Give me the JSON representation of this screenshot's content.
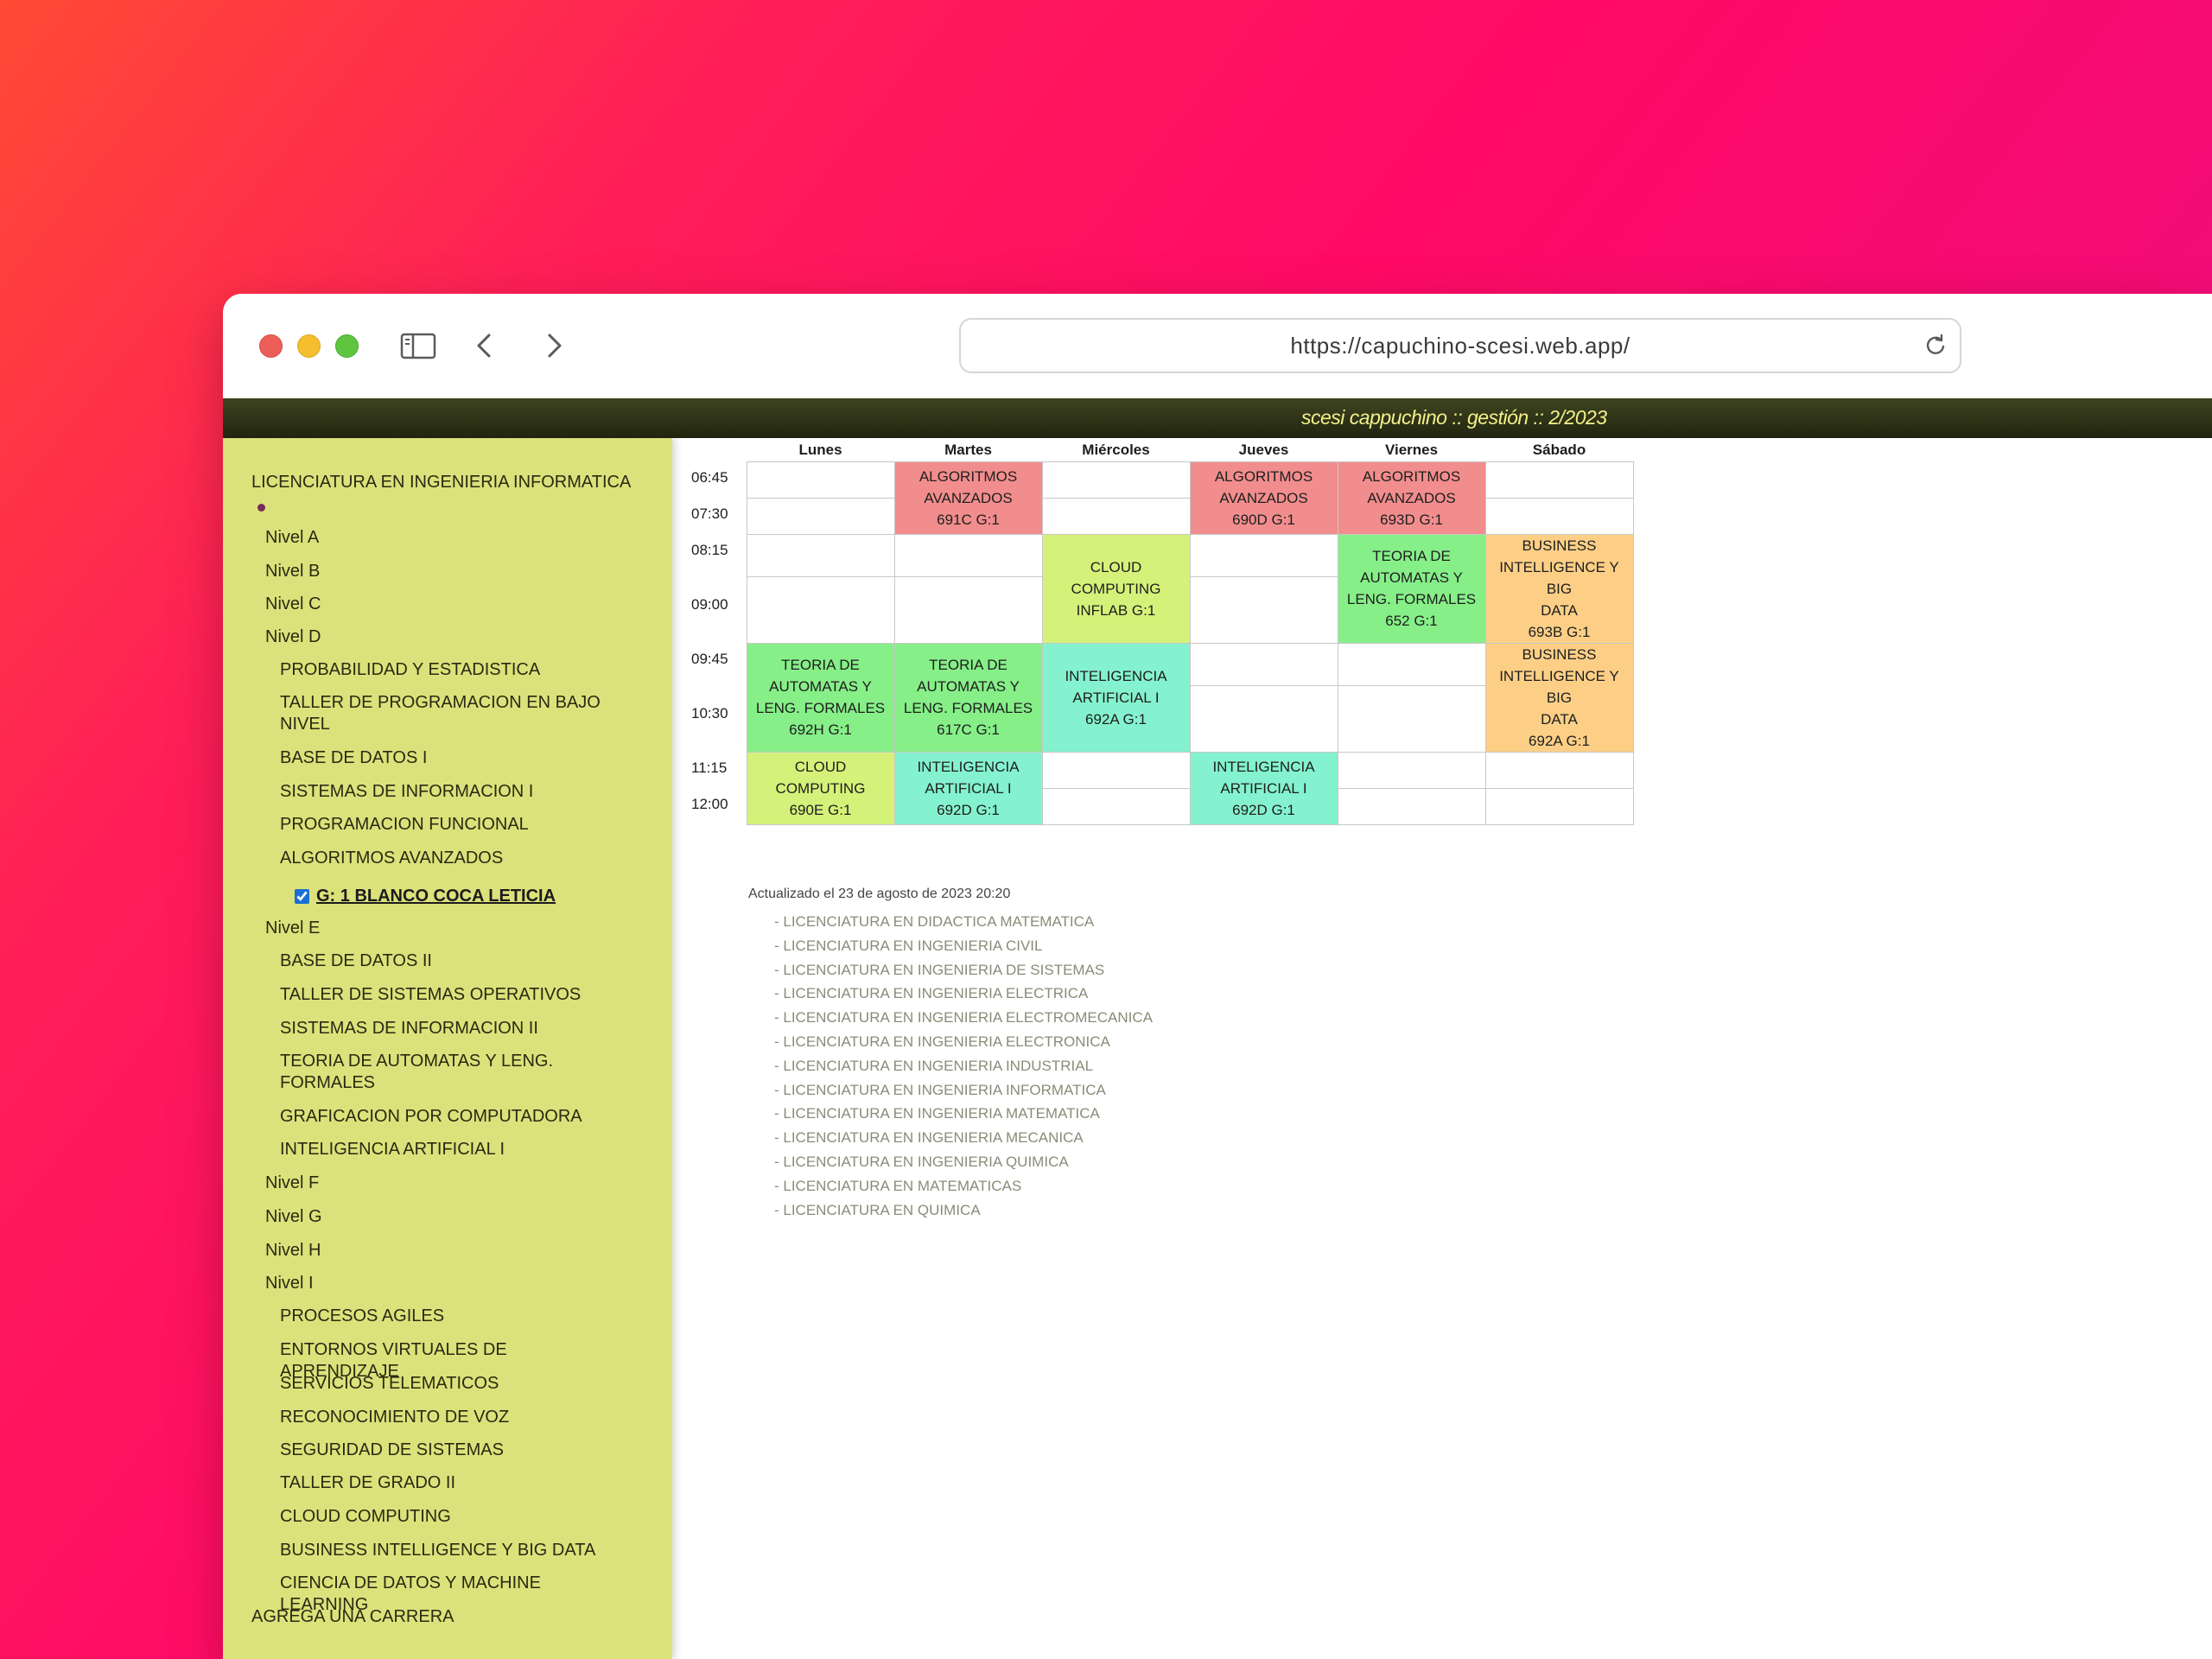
{
  "browser": {
    "url": "https://capuchino-scesi.web.app/",
    "icons": [
      "sidebar-toggle-icon",
      "back-arrow-icon",
      "forward-arrow-icon",
      "reload-icon"
    ]
  },
  "header": {
    "title": "scesi cappuchino :: gestión :: 2/2023"
  },
  "sidebar": {
    "career": "LICENCIATURA EN INGENIERIA INFORMATICA",
    "levels": {
      "a": "Nivel A",
      "b": "Nivel B",
      "c": "Nivel C",
      "d": "Nivel D",
      "e": "Nivel E",
      "f": "Nivel F",
      "g": "Nivel G",
      "h": "Nivel H",
      "i": "Nivel I"
    },
    "nivel_d_subjects": [
      "PROBABILIDAD Y ESTADISTICA",
      "TALLER DE PROGRAMACION EN BAJO NIVEL",
      "BASE DE DATOS I",
      "SISTEMAS DE INFORMACION I",
      "PROGRAMACION FUNCIONAL",
      "ALGORITMOS AVANZADOS"
    ],
    "selected_group": {
      "label": "G: 1 BLANCO COCA LETICIA",
      "checked": true
    },
    "nivel_e_subjects": [
      "BASE DE DATOS II",
      "TALLER DE SISTEMAS OPERATIVOS",
      "SISTEMAS DE INFORMACION II",
      "TEORIA DE AUTOMATAS Y LENG. FORMALES",
      "GRAFICACION POR COMPUTADORA",
      "INTELIGENCIA ARTIFICIAL I"
    ],
    "nivel_i_subjects": [
      "PROCESOS AGILES",
      "ENTORNOS VIRTUALES DE APRENDIZAJE",
      "SERVICIOS TELEMATICOS",
      "RECONOCIMIENTO DE VOZ",
      "SEGURIDAD DE SISTEMAS",
      "TALLER DE GRADO II",
      "CLOUD COMPUTING",
      "BUSINESS INTELLIGENCE Y BIG DATA",
      "CIENCIA DE DATOS Y MACHINE LEARNING"
    ],
    "add_career": "AGREGA UNA CARRERA"
  },
  "schedule": {
    "days": [
      "Lunes",
      "Martes",
      "Miércoles",
      "Jueves",
      "Viernes",
      "Sábado"
    ],
    "times": [
      "06:45",
      "07:30",
      "08:15",
      "09:00",
      "09:45",
      "10:30",
      "11:15",
      "12:00"
    ],
    "colors": {
      "red": "#f28d8d",
      "lime": "#d4f279",
      "green": "#86ef88",
      "orange": "#fdcf86",
      "teal": "#84f2cf"
    },
    "cells": {
      "mar_0645": [
        "ALGORITMOS",
        "AVANZADOS",
        "691C G:1"
      ],
      "jue_0645": [
        "ALGORITMOS",
        "AVANZADOS",
        "690D G:1"
      ],
      "vie_0645": [
        "ALGORITMOS",
        "AVANZADOS",
        "693D G:1"
      ],
      "mie_0815": [
        "CLOUD",
        "COMPUTING",
        "INFLAB G:1"
      ],
      "vie_0815": [
        "TEORIA DE",
        "AUTOMATAS Y",
        "LENG. FORMALES",
        "652 G:1"
      ],
      "sab_0815": [
        "BUSINESS",
        "INTELLIGENCE Y BIG",
        "DATA",
        "693B G:1"
      ],
      "lun_0945": [
        "TEORIA DE",
        "AUTOMATAS Y",
        "LENG. FORMALES",
        "692H G:1"
      ],
      "mar_0945": [
        "TEORIA DE",
        "AUTOMATAS Y",
        "LENG. FORMALES",
        "617C G:1"
      ],
      "mie_0945": [
        "INTELIGENCIA",
        "ARTIFICIAL I",
        "692A G:1"
      ],
      "sab_0945": [
        "BUSINESS",
        "INTELLIGENCE Y BIG",
        "DATA",
        "692A G:1"
      ],
      "lun_1115": [
        "CLOUD",
        "COMPUTING",
        "690E G:1"
      ],
      "mar_1115": [
        "INTELIGENCIA",
        "ARTIFICIAL I",
        "692D G:1"
      ],
      "jue_1115": [
        "INTELIGENCIA",
        "ARTIFICIAL I",
        "692D G:1"
      ]
    }
  },
  "updated": "Actualizado el 23 de agosto de 2023 20:20",
  "careers": [
    "- LICENCIATURA EN DIDACTICA MATEMATICA",
    "- LICENCIATURA EN INGENIERIA CIVIL",
    "- LICENCIATURA EN INGENIERIA DE SISTEMAS",
    "- LICENCIATURA EN INGENIERIA ELECTRICA",
    "- LICENCIATURA EN INGENIERIA ELECTROMECANICA",
    "- LICENCIATURA EN INGENIERIA ELECTRONICA",
    "- LICENCIATURA EN INGENIERIA INDUSTRIAL",
    "- LICENCIATURA EN INGENIERIA INFORMATICA",
    "- LICENCIATURA EN INGENIERIA MATEMATICA",
    "- LICENCIATURA EN INGENIERIA MECANICA",
    "- LICENCIATURA EN INGENIERIA QUIMICA",
    "- LICENCIATURA EN MATEMATICAS",
    "- LICENCIATURA EN QUIMICA"
  ]
}
